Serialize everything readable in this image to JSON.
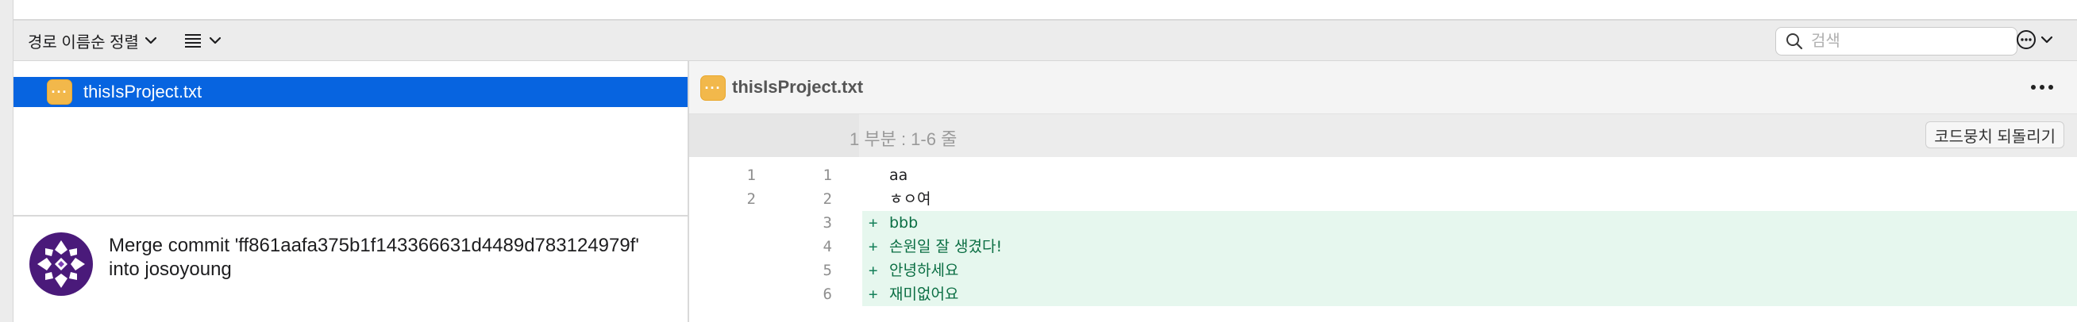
{
  "toolbar": {
    "sort_label": "경로 이름순 정렬",
    "search_placeholder": "검색"
  },
  "files": [
    {
      "name": "thisIsProject.txt",
      "selected": true
    }
  ],
  "commit": {
    "message": "Merge commit 'ff861aafa375b1f143366631d4489d783124979f' into josoyoung"
  },
  "diff": {
    "file_name": "thisIsProject.txt",
    "hunk_label": "1 부분 : 1-6 줄",
    "revert_label": "코드뭉치 되돌리기",
    "lines": [
      {
        "old": "1",
        "new": "1",
        "mark": "",
        "text": "aa",
        "added": false
      },
      {
        "old": "2",
        "new": "2",
        "mark": "",
        "text": "ㅎㅇ여",
        "added": false
      },
      {
        "old": "",
        "new": "3",
        "mark": "+",
        "text": "bbb",
        "added": true
      },
      {
        "old": "",
        "new": "4",
        "mark": "+",
        "text": "손원일 잘 생겼다!",
        "added": true
      },
      {
        "old": "",
        "new": "5",
        "mark": "+",
        "text": "안녕하세요",
        "added": true
      },
      {
        "old": "",
        "new": "6",
        "mark": "+",
        "text": "재미없어요",
        "added": true
      }
    ]
  },
  "colors": {
    "selection": "#0764e0",
    "file_badge": "#f2b84b",
    "added_bg": "#e6f7ee",
    "avatar": "#4a1a7a"
  },
  "icons": {
    "sort": "chevron-down-icon",
    "view": "list-icon",
    "search": "search-icon",
    "more": "ellipsis-circle-icon",
    "file_badge": "ellipsis-file-icon"
  }
}
